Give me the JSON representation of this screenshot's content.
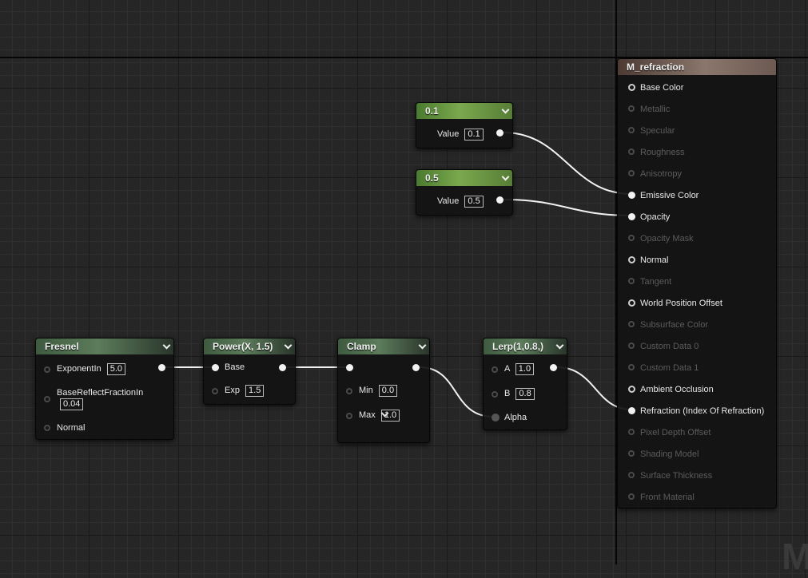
{
  "nodes": {
    "const01": {
      "title": "0.1",
      "value_label": "Value",
      "value": "0.1"
    },
    "const05": {
      "title": "0.5",
      "value_label": "Value",
      "value": "0.5"
    },
    "fresnel": {
      "title": "Fresnel",
      "exponent_label": "ExponentIn",
      "exponent_value": "5.0",
      "base_reflect_label": "BaseReflectFractionIn",
      "base_reflect_value": "0.04",
      "normal_label": "Normal"
    },
    "power": {
      "title": "Power(X, 1.5)",
      "base_label": "Base",
      "exp_label": "Exp",
      "exp_value": "1.5"
    },
    "clamp": {
      "title": "Clamp",
      "min_label": "Min",
      "min_value": "0.0",
      "max_label": "Max",
      "max_value": "1.0"
    },
    "lerp": {
      "title": "Lerp(1,0.8,)",
      "a_label": "A",
      "a_value": "1.0",
      "b_label": "B",
      "b_value": "0.8",
      "alpha_label": "Alpha"
    },
    "material": {
      "title": "M_refraction",
      "inputs": [
        {
          "label": "Base Color",
          "active": true,
          "connected": false
        },
        {
          "label": "Metallic",
          "active": false,
          "connected": false
        },
        {
          "label": "Specular",
          "active": false,
          "connected": false
        },
        {
          "label": "Roughness",
          "active": false,
          "connected": false
        },
        {
          "label": "Anisotropy",
          "active": false,
          "connected": false
        },
        {
          "label": "Emissive Color",
          "active": true,
          "connected": true
        },
        {
          "label": "Opacity",
          "active": true,
          "connected": true
        },
        {
          "label": "Opacity Mask",
          "active": false,
          "connected": false
        },
        {
          "label": "Normal",
          "active": true,
          "connected": false
        },
        {
          "label": "Tangent",
          "active": false,
          "connected": false
        },
        {
          "label": "World Position Offset",
          "active": true,
          "connected": false
        },
        {
          "label": "Subsurface Color",
          "active": false,
          "connected": false
        },
        {
          "label": "Custom Data 0",
          "active": false,
          "connected": false
        },
        {
          "label": "Custom Data 1",
          "active": false,
          "connected": false
        },
        {
          "label": "Ambient Occlusion",
          "active": true,
          "connected": false
        },
        {
          "label": "Refraction (Index Of Refraction)",
          "active": true,
          "connected": true
        },
        {
          "label": "Pixel Depth Offset",
          "active": false,
          "connected": false
        },
        {
          "label": "Shading Model",
          "active": false,
          "connected": false
        },
        {
          "label": "Surface Thickness",
          "active": false,
          "connected": false
        },
        {
          "label": "Front Material",
          "active": false,
          "connected": false
        }
      ]
    }
  },
  "watermark": "M",
  "colors": {
    "background": "#262626",
    "wire": "#ffffff",
    "constant_header": "#7aa84e",
    "result_header": "#8a766c"
  }
}
